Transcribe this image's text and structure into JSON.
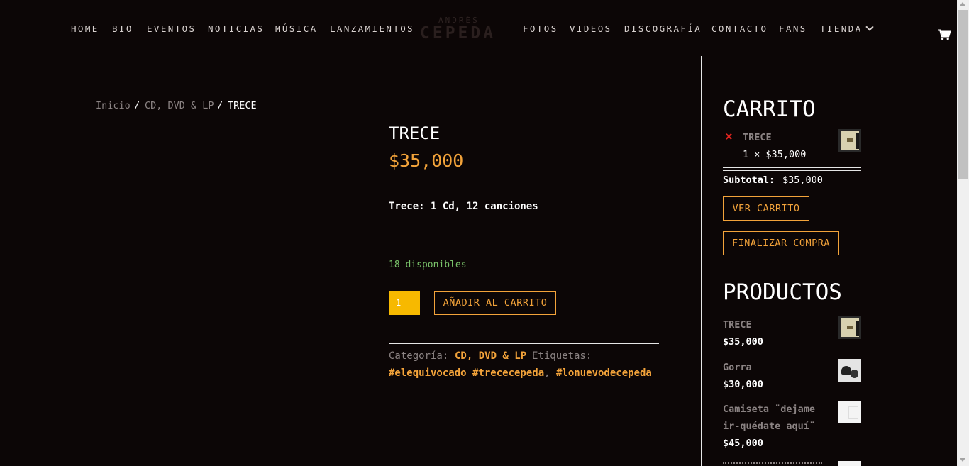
{
  "nav": {
    "left": [
      "HOME",
      "BIO",
      "EVENTOS",
      "NOTICIAS",
      "MÚSICA",
      "LANZAMIENTOS"
    ],
    "right": [
      "FOTOS",
      "VIDEOS",
      "DISCOGRAFÍA",
      "CONTACTO",
      "FANS",
      "TIENDA"
    ],
    "logo_top": "ANDRÉS",
    "logo_main": "CEPEDA"
  },
  "breadcrumb": {
    "home": "Inicio",
    "sep1": "/",
    "category": "CD, DVD & LP",
    "sep2": "/",
    "current": "TRECE"
  },
  "product": {
    "title": "TRECE",
    "price": "$35,000",
    "description": "Trece: 1 Cd, 12 canciones",
    "stock": "18 disponibles",
    "quantity": "1",
    "add_to_cart": "AÑADIR AL CARRITO",
    "category_label": "Categoría:",
    "category_value": "CD, DVD & LP",
    "tags_label": "Etiquetas:",
    "tags": [
      "#elequivocado",
      "#trececepeda",
      "#lonuevodecepeda"
    ],
    "tag_sep": ","
  },
  "cart": {
    "title": "CARRITO",
    "remove_icon": "×",
    "item_name": "TRECE",
    "item_qty_price": "1 × $35,000",
    "subtotal_label": "Subtotal:",
    "subtotal_value": "$35,000",
    "view_cart": "VER CARRITO",
    "checkout": "FINALIZAR COMPRA"
  },
  "products": {
    "title": "PRODUCTOS",
    "items": [
      {
        "name": "TRECE",
        "price": "$35,000"
      },
      {
        "name": "Gorra",
        "price": "$30,000"
      },
      {
        "name_line1": "Camiseta ¨dejame",
        "name_line2": "ir-quédate aquí¨",
        "price": "$45,000"
      }
    ]
  },
  "colors": {
    "background": "#0c0606",
    "accent": "#f3a33a",
    "stock": "#7ac36a",
    "qty_bg": "#f7b900"
  },
  "icons": [
    "cart-icon",
    "chevron-down-icon",
    "remove-icon"
  ]
}
